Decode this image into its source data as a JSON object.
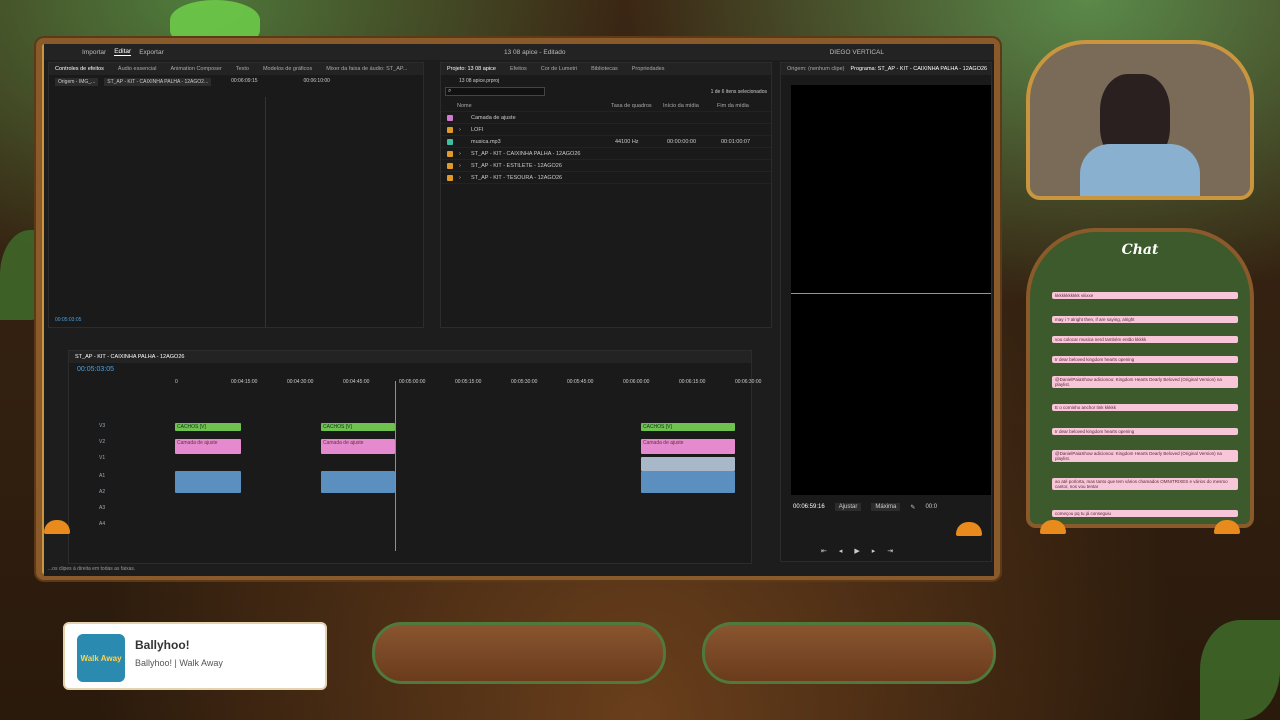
{
  "app": {
    "workspaces": [
      "Importar",
      "Editar",
      "Exportar"
    ],
    "active_workspace": "Editar",
    "title": "13 08 apice - Editado",
    "workspace_label": "DIEGO VERTICAL"
  },
  "source_panel": {
    "tabs": [
      "Controles de efeitos",
      "Áudio essencial",
      "Animation Composer",
      "Texto",
      "Modelos de gráficos",
      "Mixer da faixa de áudio: ST_AP..."
    ],
    "source_label": "Origem - IMG_...",
    "clip_label": "ST_AP - KIT - CAIXINHA PALHA - 12AGO2...",
    "tc1": "00:06:09:15",
    "tc2": "00:06:10:00",
    "timecode": "00:05:03:05"
  },
  "project_panel": {
    "tabs": [
      "Projeto: 13 08 apice",
      "Efeitos",
      "Cor de Lumetri",
      "Bibliotecas",
      "Propriedades"
    ],
    "file": "13 08 apice.prproj",
    "count": "1 de 6 itens selecionados",
    "columns": [
      "Nome",
      "Taxa de quadros",
      "Início da mídia",
      "Fim da mídia"
    ],
    "items": [
      {
        "name": "Camada de ajuste",
        "color": "#d07ad0",
        "rate": "",
        "start": "",
        "end": ""
      },
      {
        "name": "LOFI",
        "color": "#e09a2a",
        "rate": "",
        "start": "",
        "end": ""
      },
      {
        "name": "musica.mp3",
        "color": "#3cc0a0",
        "rate": "44100 Hz",
        "start": "00:00:00:00",
        "end": "00:01:00:07"
      },
      {
        "name": "ST_AP - KIT - CAIXINHA PALHA - 12AGO26",
        "color": "#e09a2a",
        "rate": "",
        "start": "",
        "end": ""
      },
      {
        "name": "ST_AP - KIT - ESTILETE - 12AGO26",
        "color": "#e09a2a",
        "rate": "",
        "start": "",
        "end": ""
      },
      {
        "name": "ST_AP - KIT - TESOURA - 12AGO26",
        "color": "#e09a2a",
        "rate": "",
        "start": "",
        "end": ""
      }
    ]
  },
  "program_panel": {
    "source_tab": "Origem: (nenhum clipe)",
    "program_tab": "Programa: ST_AP - KIT - CAIXINHA PALHA - 12AGO26",
    "timecode": "00:06:59:16",
    "fit": "Ajustar",
    "quality": "Máxima",
    "tc_right": "00:0"
  },
  "timeline": {
    "sequence": "ST_AP - KIT - CAIXINHA PALHA - 12AGO26",
    "timecode": "00:05:03:05",
    "ruler": [
      "0",
      "00:04:15:00",
      "00:04:30:00",
      "00:04:45:00",
      "00:05:00:00",
      "00:05:15:00",
      "00:05:30:00",
      "00:05:45:00",
      "00:06:00:00",
      "00:06:15:00",
      "00:06:30:00"
    ],
    "tracks": [
      "V3",
      "V2",
      "V1",
      "A1",
      "A2",
      "A3",
      "A4"
    ],
    "clip_v": "CACHOS [V]",
    "clip_adj": "Camada de ajuste",
    "status": "Clique para selecionar ou clique em um espaço vazio e arraste para selecionar com retângulo. Use Shift, Alt e Ctrl para outras opções"
  },
  "status_text": "...os clipes à direita em todas as faixas.",
  "chat": {
    "title": "Chat",
    "messages": [
      "kkkkkkkkkkk viiixxe",
      "may i ? alright then, if are saying, alright",
      "vou colocar musica nerd também então kkkkk",
      "Ir dear beloved kingdom hearts opening",
      "@DanielPaiaShow adicionou: Kingdom Hearts Dearly Beloved (Original Version) na playlist.",
      "E o corninho anchor tink kkkkk",
      "Ir dear beloved kingdom hearts opening",
      "@DanielPaiaShow adicionou: Kingdom Hearts Dearly Beloved (Original Version) na playlist.",
      "ao até porlorta, mas tanto que tem vários chamados OMNITRIXES e vários do mesmo cantor, nos vou tentar",
      "começou pq tu já conseguiu"
    ]
  },
  "now_playing": {
    "title": "Ballyhoo!",
    "subtitle": "Ballyhoo! | Walk Away",
    "art_text": "Walk Away"
  }
}
